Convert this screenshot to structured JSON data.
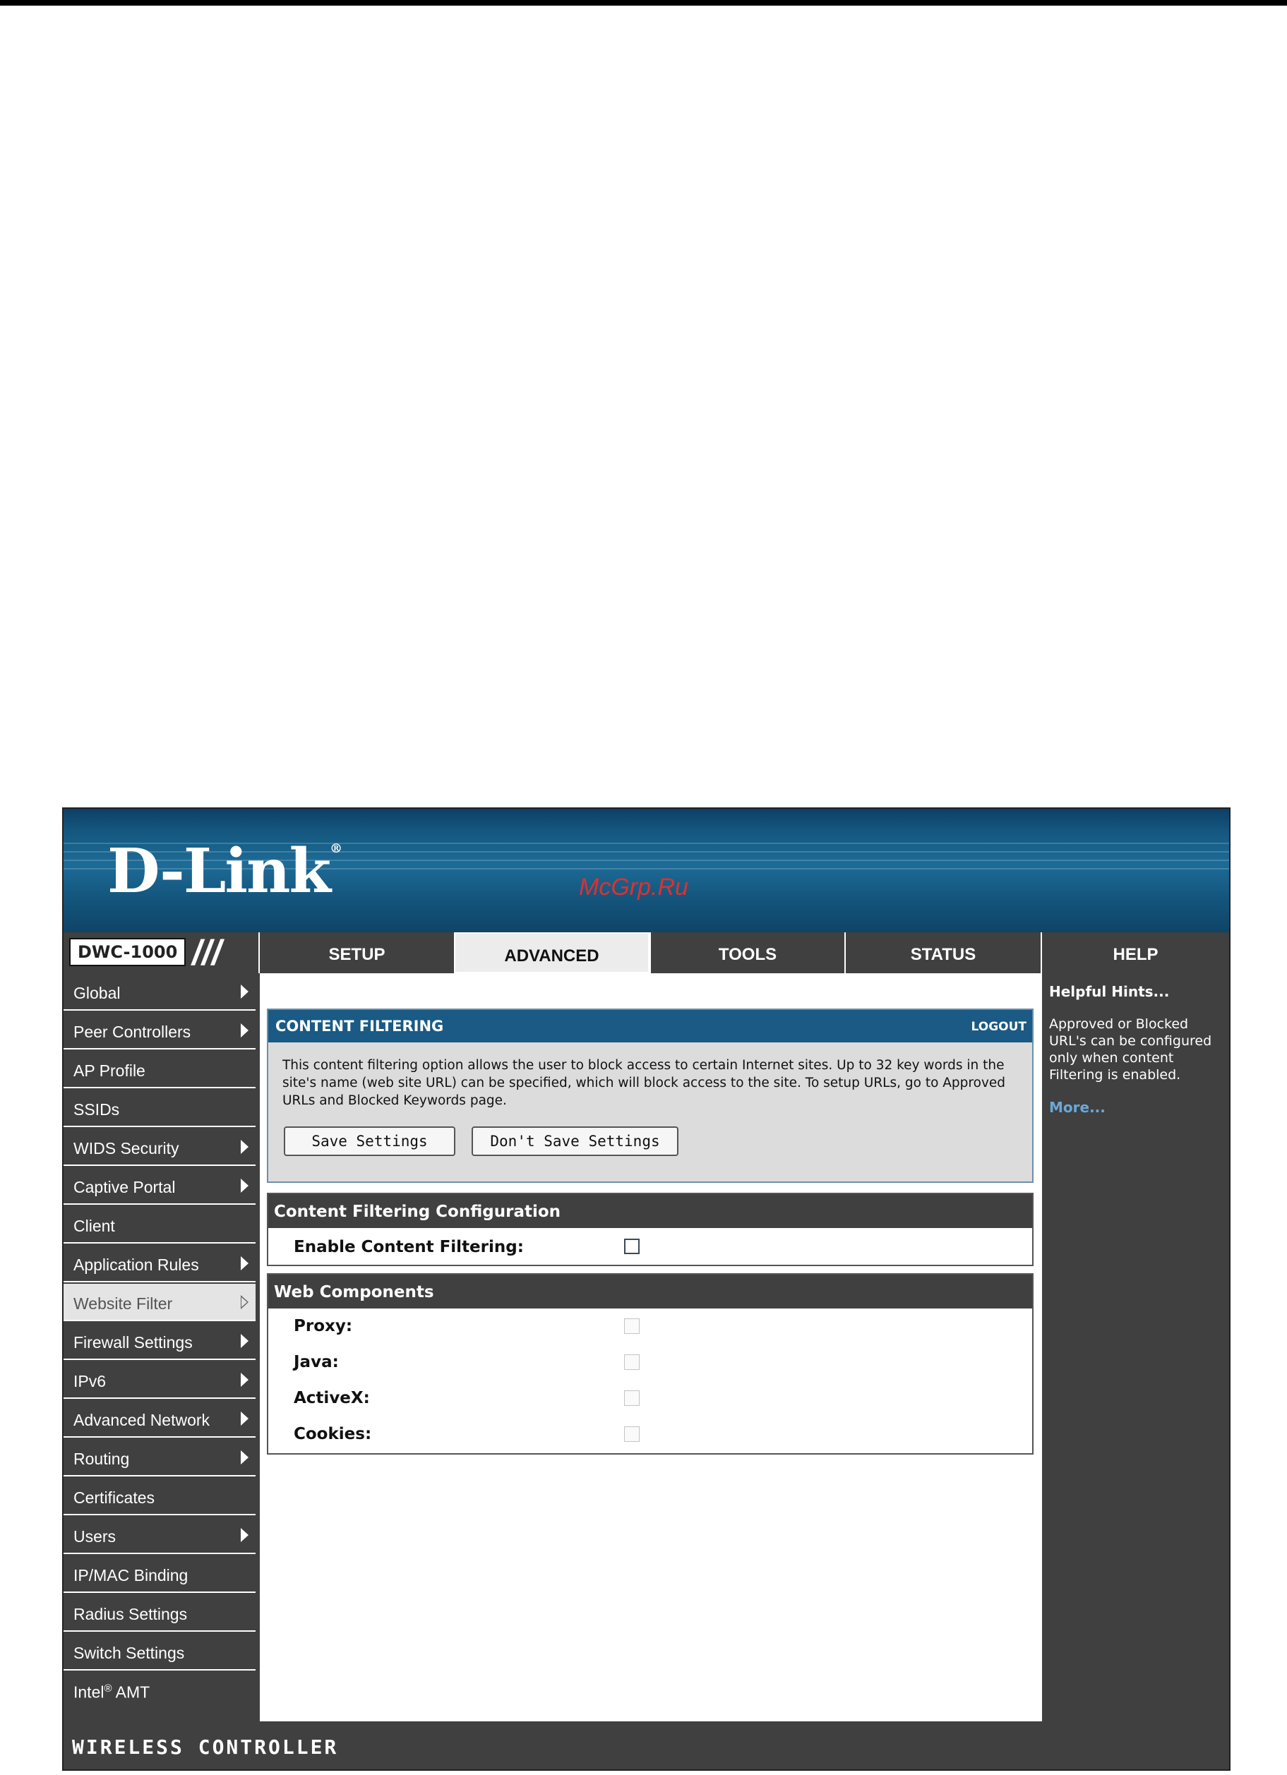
{
  "header": {
    "brand": "D-Link",
    "brand_mark": "®",
    "watermark": "McGrp.Ru"
  },
  "nav": {
    "model": "DWC-1000",
    "tabs": [
      {
        "label": "SETUP",
        "active": false
      },
      {
        "label": "ADVANCED",
        "active": true
      },
      {
        "label": "TOOLS",
        "active": false
      },
      {
        "label": "STATUS",
        "active": false
      },
      {
        "label": "HELP",
        "active": false
      }
    ]
  },
  "sidebar": {
    "items": [
      {
        "label": "Global",
        "arrow": true
      },
      {
        "label": "Peer Controllers",
        "arrow": true
      },
      {
        "label": "AP Profile",
        "arrow": false
      },
      {
        "label": "SSIDs",
        "arrow": false
      },
      {
        "label": "WIDS Security",
        "arrow": true
      },
      {
        "label": "Captive Portal",
        "arrow": true
      },
      {
        "label": "Client",
        "arrow": false
      },
      {
        "label": "Application Rules",
        "arrow": true
      },
      {
        "label": "Website Filter",
        "arrow": true,
        "active": true
      },
      {
        "label": "Firewall Settings",
        "arrow": true
      },
      {
        "label": "IPv6",
        "arrow": true
      },
      {
        "label": "Advanced Network",
        "arrow": true
      },
      {
        "label": "Routing",
        "arrow": true
      },
      {
        "label": "Certificates",
        "arrow": false
      },
      {
        "label": "Users",
        "arrow": true
      },
      {
        "label": "IP/MAC Binding",
        "arrow": false
      },
      {
        "label": "Radius Settings",
        "arrow": false
      },
      {
        "label": "Switch Settings",
        "arrow": false
      },
      {
        "label": "Intel",
        "sup": "®",
        "suffix": " AMT",
        "arrow": false
      }
    ]
  },
  "content": {
    "panel_title": "CONTENT FILTERING",
    "logout": "LOGOUT",
    "description": "This content filtering option allows the user to block access to certain Internet sites. Up to 32 key words in the site's name (web site URL) can be specified, which will block access to the site. To setup URLs, go to Approved URLs and Blocked Keywords page.",
    "save_button": "Save Settings",
    "dont_save_button": "Don't Save Settings",
    "config_section": {
      "title": "Content Filtering Configuration",
      "enable_label": "Enable Content Filtering:",
      "enable_checked": false
    },
    "web_components": {
      "title": "Web Components",
      "items": [
        {
          "label": "Proxy:",
          "checked": false,
          "disabled": true
        },
        {
          "label": "Java:",
          "checked": false,
          "disabled": true
        },
        {
          "label": "ActiveX:",
          "checked": false,
          "disabled": true
        },
        {
          "label": "Cookies:",
          "checked": false,
          "disabled": true
        }
      ]
    }
  },
  "help": {
    "title": "Helpful Hints...",
    "text": "Approved or Blocked URL's can be configured only when content Filtering is enabled.",
    "more": "More..."
  },
  "footer": {
    "label": "WIRELESS CONTROLLER"
  },
  "colors": {
    "nav_bg": "#404040",
    "panel_header": "#1a5a84",
    "banner_blue": "#1d6c98",
    "help_link": "#6aa8d8"
  }
}
